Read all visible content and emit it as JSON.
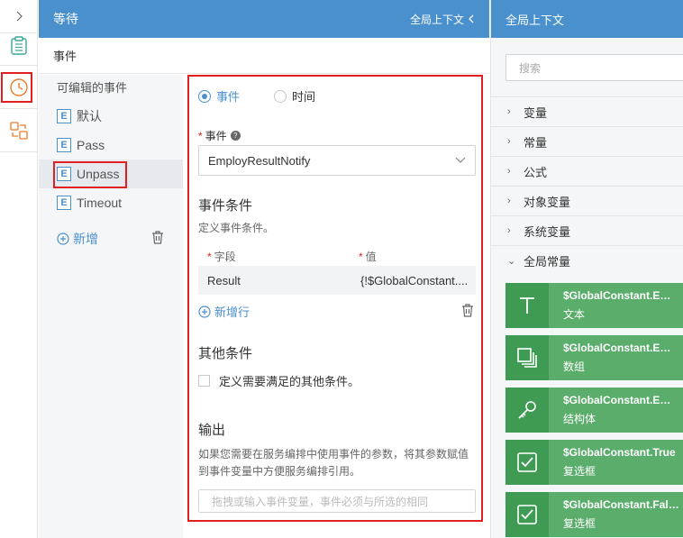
{
  "rail": {
    "items": [
      {
        "icon": "chevron-right-icon"
      },
      {
        "icon": "list-icon"
      },
      {
        "icon": "clock-icon",
        "active": true
      },
      {
        "icon": "flow-icon"
      }
    ]
  },
  "header": {
    "title": "等待",
    "context_link": "全局上下文"
  },
  "subheader": {
    "title": "事件"
  },
  "events": {
    "caption": "可编辑的事件",
    "badge": "E",
    "items": [
      "默认",
      "Pass",
      "Unpass",
      "Timeout"
    ],
    "selected": "Unpass",
    "add_label": "新增"
  },
  "form": {
    "radio_event": "事件",
    "radio_time": "时间",
    "selected_radio": "事件",
    "event_label": "事件",
    "required_mark": "*",
    "help_mark": "?",
    "event_value": "EmployResultNotify",
    "conditions_title": "事件条件",
    "conditions_desc": "定义事件条件。",
    "col_field": "字段",
    "col_value": "值",
    "row_field": "Result",
    "row_value": "{!$GlobalConstant....",
    "new_row_label": "新增行",
    "other_title": "其他条件",
    "other_check_label": "定义需要满足的其他条件。",
    "output_title": "输出",
    "output_desc_1": "如果您需要在服务编排中使用事件的参数，将其参数赋值",
    "output_desc_2": "到事件变量中方便服务编排引用。",
    "output_placeholder": "拖拽或输入事件变量，事件必须与所选的相同"
  },
  "right": {
    "title": "全局上下文",
    "search_placeholder": "搜索",
    "tree": [
      {
        "label": "变量",
        "expanded": false
      },
      {
        "label": "常量",
        "expanded": false
      },
      {
        "label": "公式",
        "expanded": false
      },
      {
        "label": "对象变量",
        "expanded": false
      },
      {
        "label": "系统变量",
        "expanded": false
      },
      {
        "label": "全局常量",
        "expanded": true
      }
    ],
    "cards": [
      {
        "name": "$GlobalConstant.Emp...",
        "type": "文本",
        "icon": "text-icon"
      },
      {
        "name": "$GlobalConstant.Emp...",
        "type": "数组",
        "icon": "array-icon"
      },
      {
        "name": "$GlobalConstant.Emp...",
        "type": "结构体",
        "icon": "key-icon"
      },
      {
        "name": "$GlobalConstant.True",
        "type": "复选框",
        "icon": "checkbox-icon"
      },
      {
        "name": "$GlobalConstant.False",
        "type": "复选框",
        "icon": "checkbox-icon"
      }
    ],
    "card_color": "#5aad6b"
  },
  "colors": {
    "accent": "#4a90cc",
    "highlight": "#e02020"
  }
}
